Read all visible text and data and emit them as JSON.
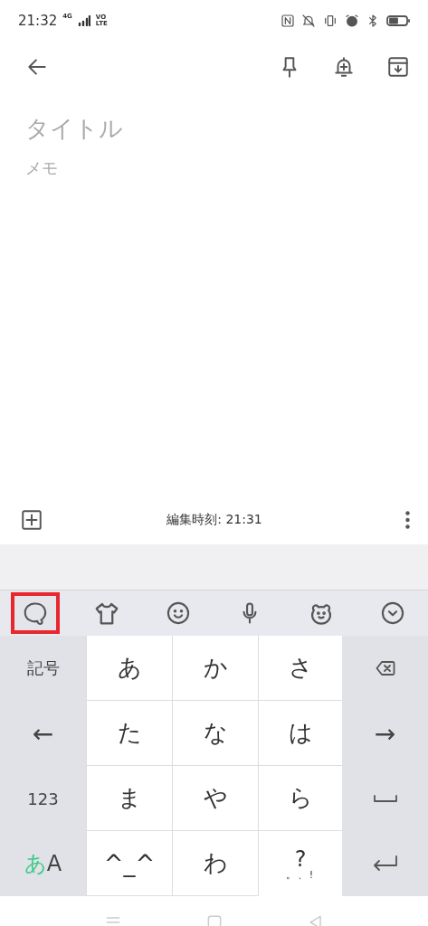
{
  "status_bar": {
    "time": "21:32",
    "network": "4G",
    "volte_top": "VO",
    "volte_bottom": "LTE"
  },
  "note": {
    "title_placeholder": "タイトル",
    "body_placeholder": "メモ"
  },
  "bottom_bar": {
    "edited": "編集時刻: 21:31"
  },
  "keyboard_toolbar": [
    {
      "kind": "chat",
      "selected": true
    },
    {
      "kind": "shirt",
      "selected": false
    },
    {
      "kind": "smiley",
      "selected": false
    },
    {
      "kind": "mic",
      "selected": false
    },
    {
      "kind": "bear",
      "selected": false
    },
    {
      "kind": "collapse",
      "selected": false
    }
  ],
  "keys": [
    {
      "kind": "side",
      "label": "記号"
    },
    {
      "kind": "char",
      "label": "あ"
    },
    {
      "kind": "char",
      "label": "か"
    },
    {
      "kind": "char",
      "label": "さ"
    },
    {
      "kind": "backspace"
    },
    {
      "kind": "side",
      "label": "←"
    },
    {
      "kind": "char",
      "label": "た"
    },
    {
      "kind": "char",
      "label": "な"
    },
    {
      "kind": "char",
      "label": "は"
    },
    {
      "kind": "side",
      "label": "→"
    },
    {
      "kind": "side",
      "label": "123"
    },
    {
      "kind": "char",
      "label": "ま"
    },
    {
      "kind": "char",
      "label": "や"
    },
    {
      "kind": "char",
      "label": "ら"
    },
    {
      "kind": "space"
    },
    {
      "kind": "mode",
      "label": "あ",
      "label2": "A"
    },
    {
      "kind": "char",
      "label": "^_^"
    },
    {
      "kind": "char",
      "label": "わ"
    },
    {
      "kind": "punct",
      "label": "?",
      "label2": "。、!"
    },
    {
      "kind": "enter"
    }
  ]
}
